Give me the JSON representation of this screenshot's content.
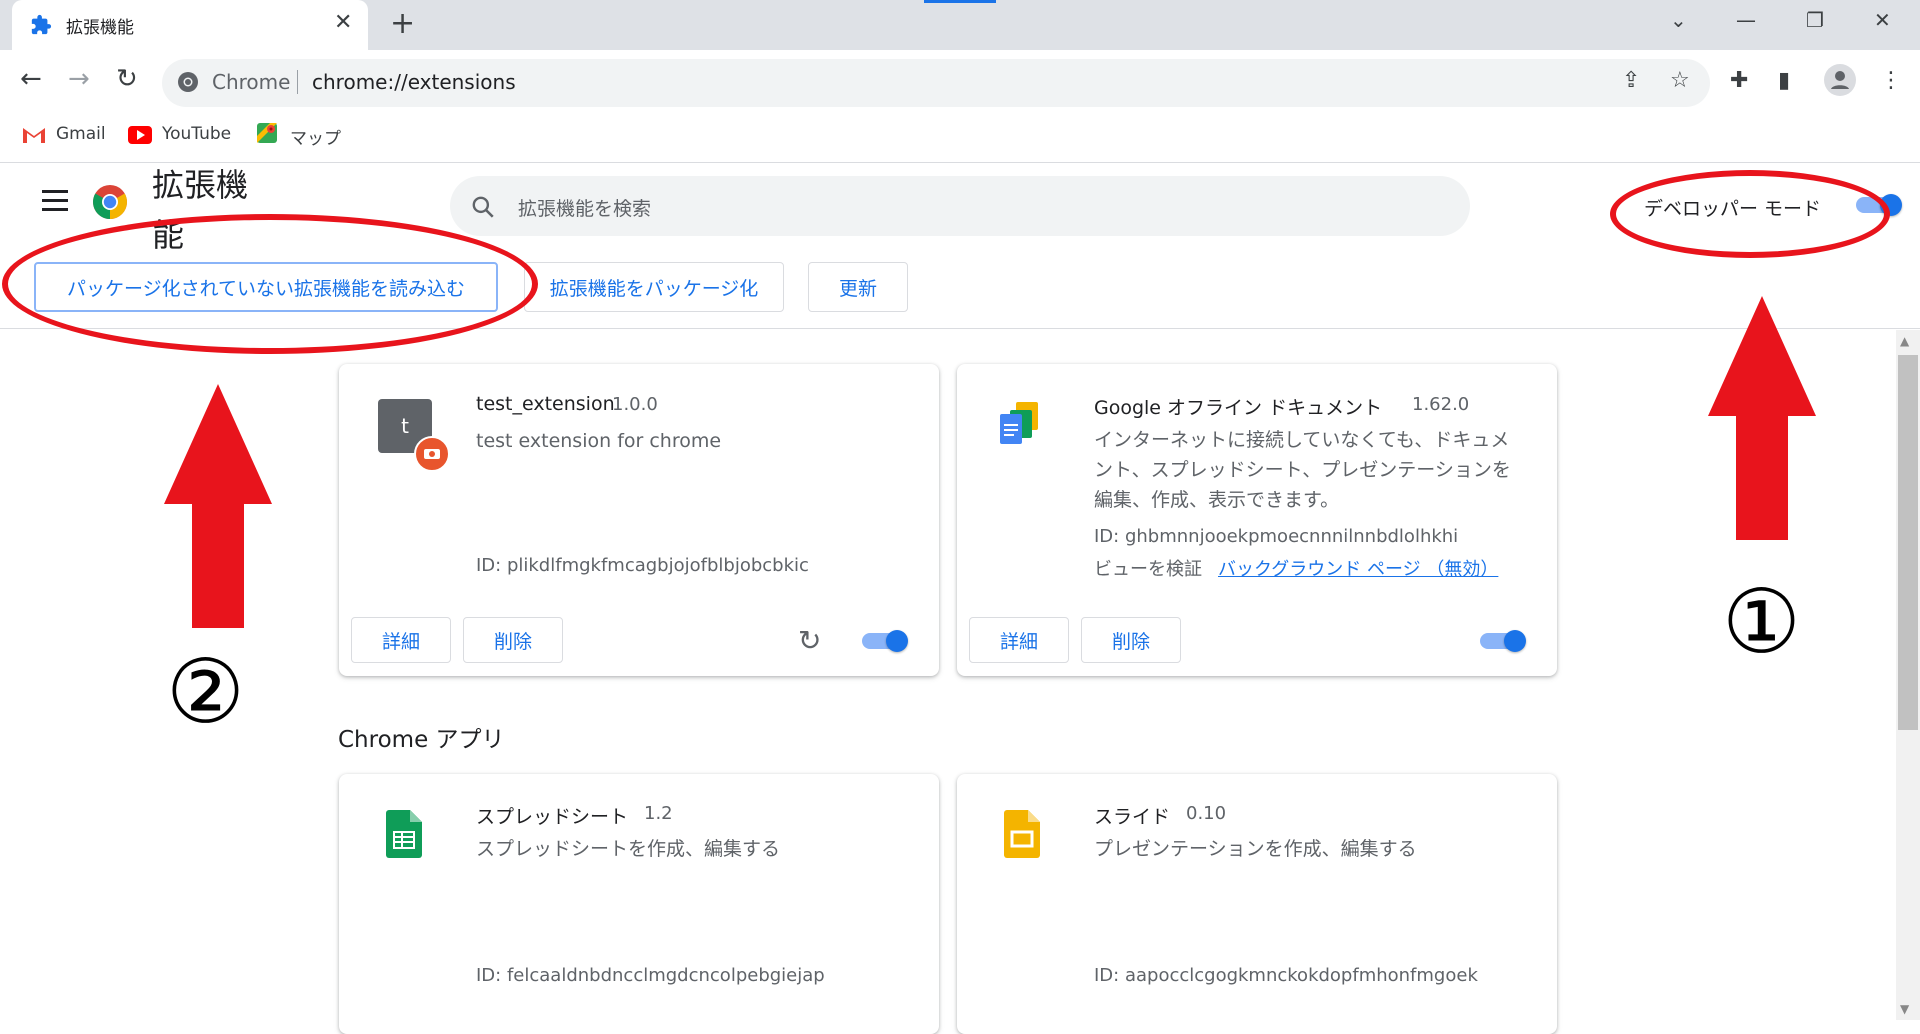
{
  "browser": {
    "tab_title": "拡張機能",
    "tab_close": "✕",
    "new_tab": "+",
    "win_chevron": "⌄",
    "win_minimize": "—",
    "win_restore": "❐",
    "win_close": "✕",
    "back": "←",
    "forward": "→",
    "reload": "↻",
    "omnibox_chrome": "Chrome",
    "omnibox_url": "chrome://extensions",
    "share_icon": "⇪",
    "star_icon": "☆",
    "puzzle_icon": "✚",
    "side_panel_icon": "▮",
    "more_icon": "⋮"
  },
  "bookmarks": [
    {
      "label": "Gmail",
      "icon": "gmail-icon"
    },
    {
      "label": "YouTube",
      "icon": "youtube-icon"
    },
    {
      "label": "マップ",
      "icon": "maps-icon"
    }
  ],
  "header": {
    "title": "拡張機能",
    "search_placeholder": "拡張機能を検索",
    "dev_mode_label": "デベロッパー モード",
    "dev_mode_on": true
  },
  "actions": {
    "load_unpacked": "パッケージ化されていない拡張機能を読み込む",
    "pack": "拡張機能をパッケージ化",
    "update": "更新"
  },
  "extensions": [
    {
      "name": "test_extension",
      "version": "1.0.0",
      "description": "test extension for chrome",
      "id": "ID: plikdlfmgkfmcagbjojofblbjobcbkic",
      "icon_letter": "t",
      "details": "詳細",
      "remove": "削除",
      "reload_icon": "↻",
      "enabled": true
    },
    {
      "name": "Google オフライン ドキュメント",
      "version": "1.62.0",
      "description_lines": [
        "インターネットに接続していなくても、ドキュメ",
        "ント、スプレッドシート、プレゼンテーションを",
        "編集、作成、表示できます。"
      ],
      "id": "ID: ghbmnnjooekpmoecnnnilnnbdlolhkhi",
      "inspect_label": "ビューを検証",
      "inspect_link": "バックグラウンド ページ （無効）",
      "details": "詳細",
      "remove": "削除",
      "enabled": true
    }
  ],
  "apps_section": {
    "title": "Chrome アプリ",
    "apps": [
      {
        "name": "スプレッドシート",
        "version": "1.2",
        "description": "スプレッドシートを作成、編集する",
        "id": "ID: felcaaldnbdncclmgdcncolpebgiejap"
      },
      {
        "name": "スライド",
        "version": "0.10",
        "description": "プレゼンテーションを作成、編集する",
        "id": "ID: aapocclcgogkmnckokdopfmhonfmgoek"
      }
    ]
  },
  "annotations": {
    "marker_1": "①",
    "marker_2": "②",
    "color": "#e8141c"
  },
  "scrollbar": {
    "up": "▲",
    "down": "▼"
  }
}
